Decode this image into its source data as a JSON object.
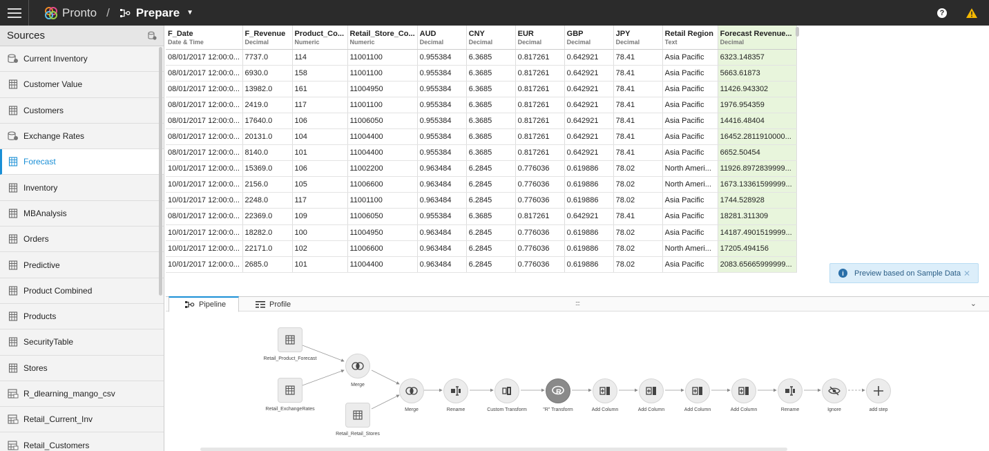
{
  "header": {
    "brand": "Pronto",
    "separator": "/",
    "page": "Prepare"
  },
  "sidebar": {
    "title": "Sources",
    "items": [
      {
        "label": "Current Inventory",
        "icon": "database-link-icon"
      },
      {
        "label": "Customer Value",
        "icon": "table-icon"
      },
      {
        "label": "Customers",
        "icon": "table-icon"
      },
      {
        "label": "Exchange Rates",
        "icon": "database-link-icon"
      },
      {
        "label": "Forecast",
        "icon": "table-icon",
        "active": true
      },
      {
        "label": "Inventory",
        "icon": "table-icon"
      },
      {
        "label": "MBAnalysis",
        "icon": "table-icon"
      },
      {
        "label": "Orders",
        "icon": "table-icon"
      },
      {
        "label": "Predictive",
        "icon": "table-icon"
      },
      {
        "label": "Product Combined",
        "icon": "table-icon"
      },
      {
        "label": "Products",
        "icon": "table-icon"
      },
      {
        "label": "SecurityTable",
        "icon": "table-icon"
      },
      {
        "label": "Stores",
        "icon": "table-icon"
      },
      {
        "label": "R_dlearning_mango_csv",
        "icon": "file-table-icon"
      },
      {
        "label": "Retail_Current_Inv",
        "icon": "file-table-icon"
      },
      {
        "label": "Retail_Customers",
        "icon": "file-table-icon"
      }
    ]
  },
  "grid": {
    "columns": [
      {
        "name": "F_Date",
        "type": "Date & Time"
      },
      {
        "name": "F_Revenue",
        "type": "Decimal"
      },
      {
        "name": "Product_Co...",
        "type": "Numeric"
      },
      {
        "name": "Retail_Store_Co...",
        "type": "Numeric"
      },
      {
        "name": "AUD",
        "type": "Decimal"
      },
      {
        "name": "CNY",
        "type": "Decimal"
      },
      {
        "name": "EUR",
        "type": "Decimal"
      },
      {
        "name": "GBP",
        "type": "Decimal"
      },
      {
        "name": "JPY",
        "type": "Decimal"
      },
      {
        "name": "Retail Region",
        "type": "Text"
      },
      {
        "name": "Forecast Revenue...",
        "type": "Decimal"
      }
    ],
    "rows": [
      [
        "08/01/2017 12:00:0...",
        "7737.0",
        "114",
        "11001100",
        "0.955384",
        "6.3685",
        "0.817261",
        "0.642921",
        "78.41",
        "Asia Pacific",
        "6323.148357"
      ],
      [
        "08/01/2017 12:00:0...",
        "6930.0",
        "158",
        "11001100",
        "0.955384",
        "6.3685",
        "0.817261",
        "0.642921",
        "78.41",
        "Asia Pacific",
        "5663.61873"
      ],
      [
        "08/01/2017 12:00:0...",
        "13982.0",
        "161",
        "11004950",
        "0.955384",
        "6.3685",
        "0.817261",
        "0.642921",
        "78.41",
        "Asia Pacific",
        "11426.943302"
      ],
      [
        "08/01/2017 12:00:0...",
        "2419.0",
        "117",
        "11001100",
        "0.955384",
        "6.3685",
        "0.817261",
        "0.642921",
        "78.41",
        "Asia Pacific",
        "1976.954359"
      ],
      [
        "08/01/2017 12:00:0...",
        "17640.0",
        "106",
        "11006050",
        "0.955384",
        "6.3685",
        "0.817261",
        "0.642921",
        "78.41",
        "Asia Pacific",
        "14416.48404"
      ],
      [
        "08/01/2017 12:00:0...",
        "20131.0",
        "104",
        "11004400",
        "0.955384",
        "6.3685",
        "0.817261",
        "0.642921",
        "78.41",
        "Asia Pacific",
        "16452.2811910000..."
      ],
      [
        "08/01/2017 12:00:0...",
        "8140.0",
        "101",
        "11004400",
        "0.955384",
        "6.3685",
        "0.817261",
        "0.642921",
        "78.41",
        "Asia Pacific",
        "6652.50454"
      ],
      [
        "10/01/2017 12:00:0...",
        "15369.0",
        "106",
        "11002200",
        "0.963484",
        "6.2845",
        "0.776036",
        "0.619886",
        "78.02",
        "North Ameri...",
        "11926.8972839999..."
      ],
      [
        "10/01/2017 12:00:0...",
        "2156.0",
        "105",
        "11006600",
        "0.963484",
        "6.2845",
        "0.776036",
        "0.619886",
        "78.02",
        "North Ameri...",
        "1673.13361599999..."
      ],
      [
        "10/01/2017 12:00:0...",
        "2248.0",
        "117",
        "11001100",
        "0.963484",
        "6.2845",
        "0.776036",
        "0.619886",
        "78.02",
        "Asia Pacific",
        "1744.528928"
      ],
      [
        "08/01/2017 12:00:0...",
        "22369.0",
        "109",
        "11006050",
        "0.955384",
        "6.3685",
        "0.817261",
        "0.642921",
        "78.41",
        "Asia Pacific",
        "18281.311309"
      ],
      [
        "10/01/2017 12:00:0...",
        "18282.0",
        "100",
        "11004950",
        "0.963484",
        "6.2845",
        "0.776036",
        "0.619886",
        "78.02",
        "Asia Pacific",
        "14187.4901519999..."
      ],
      [
        "10/01/2017 12:00:0...",
        "22171.0",
        "102",
        "11006600",
        "0.963484",
        "6.2845",
        "0.776036",
        "0.619886",
        "78.02",
        "North Ameri...",
        "17205.494156"
      ],
      [
        "10/01/2017 12:00:0...",
        "2685.0",
        "101",
        "11004400",
        "0.963484",
        "6.2845",
        "0.776036",
        "0.619886",
        "78.02",
        "Asia Pacific",
        "2083.65665999999..."
      ]
    ]
  },
  "toast": {
    "text": "Preview based on Sample Data"
  },
  "panel": {
    "tabs": [
      {
        "label": "Pipeline",
        "active": true
      },
      {
        "label": "Profile",
        "active": false
      }
    ],
    "drag_handle": "::::"
  },
  "pipeline": {
    "nodes": [
      {
        "label": "Retail_Product_Forecast",
        "kind": "source",
        "icon": "table-icon"
      },
      {
        "label": "Retail_ExchangeRates",
        "kind": "source",
        "icon": "table-icon"
      },
      {
        "label": "Merge",
        "kind": "step",
        "icon": "merge-icon"
      },
      {
        "label": "Retail_Retail_Stores",
        "kind": "source",
        "icon": "table-icon"
      },
      {
        "label": "Merge",
        "kind": "step",
        "icon": "merge-icon"
      },
      {
        "label": "Rename",
        "kind": "step",
        "icon": "rename-icon"
      },
      {
        "label": "Custom Transform",
        "kind": "step",
        "icon": "custom-transform-icon"
      },
      {
        "label": "\"R\" Transform",
        "kind": "step",
        "icon": "r-transform-icon",
        "highlight": true
      },
      {
        "label": "Add Column",
        "kind": "step",
        "icon": "add-column-icon"
      },
      {
        "label": "Add Column",
        "kind": "step",
        "icon": "add-column-icon"
      },
      {
        "label": "Add Column",
        "kind": "step",
        "icon": "add-column-icon"
      },
      {
        "label": "Add Column",
        "kind": "step",
        "icon": "add-column-icon"
      },
      {
        "label": "Rename",
        "kind": "step",
        "icon": "rename-icon"
      },
      {
        "label": "Ignore",
        "kind": "step",
        "icon": "ignore-icon"
      },
      {
        "label": "add step",
        "kind": "add",
        "icon": "plus-icon"
      }
    ]
  },
  "colors": {
    "accent": "#1a8fd6",
    "topbar": "#2b2b2b",
    "highlight_column": "#e8f5dc",
    "warning": "#f5b800"
  }
}
